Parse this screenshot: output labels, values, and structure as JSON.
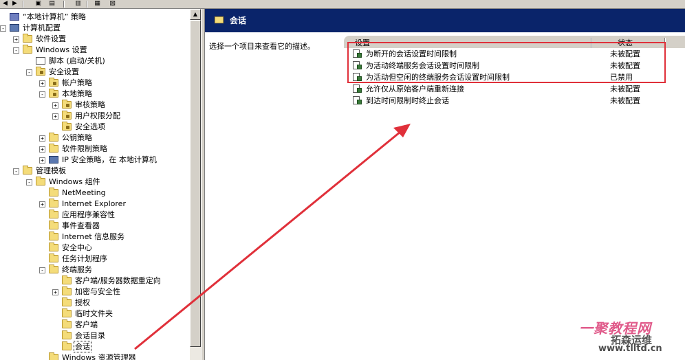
{
  "tree": [
    {
      "label": "“本地计算机” 策略",
      "depth": 0,
      "expander": "",
      "icon": "policy"
    },
    {
      "label": "计算机配置",
      "depth": 0,
      "expander": "-",
      "icon": "computer"
    },
    {
      "label": "软件设置",
      "depth": 1,
      "expander": "+",
      "icon": "folder"
    },
    {
      "label": "Windows 设置",
      "depth": 1,
      "expander": "-",
      "icon": "folder"
    },
    {
      "label": "脚本 (启动/关机)",
      "depth": 2,
      "expander": "",
      "icon": "script"
    },
    {
      "label": "安全设置",
      "depth": 2,
      "expander": "-",
      "icon": "lockfolder"
    },
    {
      "label": "帐户策略",
      "depth": 3,
      "expander": "+",
      "icon": "lockfolder"
    },
    {
      "label": "本地策略",
      "depth": 3,
      "expander": "-",
      "icon": "lockfolder"
    },
    {
      "label": "审核策略",
      "depth": 4,
      "expander": "+",
      "icon": "lockfolder"
    },
    {
      "label": "用户权限分配",
      "depth": 4,
      "expander": "+",
      "icon": "lockfolder"
    },
    {
      "label": "安全选项",
      "depth": 4,
      "expander": "",
      "icon": "lockfolder"
    },
    {
      "label": "公钥策略",
      "depth": 3,
      "expander": "+",
      "icon": "folder"
    },
    {
      "label": "软件限制策略",
      "depth": 3,
      "expander": "+",
      "icon": "folder"
    },
    {
      "label": "IP 安全策略，在 本地计算机",
      "depth": 3,
      "expander": "+",
      "icon": "computer"
    },
    {
      "label": "管理模板",
      "depth": 1,
      "expander": "-",
      "icon": "folder"
    },
    {
      "label": "Windows 组件",
      "depth": 2,
      "expander": "-",
      "icon": "folder"
    },
    {
      "label": "NetMeeting",
      "depth": 3,
      "expander": "",
      "icon": "folder"
    },
    {
      "label": "Internet Explorer",
      "depth": 3,
      "expander": "+",
      "icon": "folder"
    },
    {
      "label": "应用程序兼容性",
      "depth": 3,
      "expander": "",
      "icon": "folder"
    },
    {
      "label": "事件查看器",
      "depth": 3,
      "expander": "",
      "icon": "folder"
    },
    {
      "label": "Internet 信息服务",
      "depth": 3,
      "expander": "",
      "icon": "folder"
    },
    {
      "label": "安全中心",
      "depth": 3,
      "expander": "",
      "icon": "folder"
    },
    {
      "label": "任务计划程序",
      "depth": 3,
      "expander": "",
      "icon": "folder"
    },
    {
      "label": "终端服务",
      "depth": 3,
      "expander": "-",
      "icon": "folder"
    },
    {
      "label": "客户端/服务器数据重定向",
      "depth": 4,
      "expander": "",
      "icon": "folder"
    },
    {
      "label": "加密与安全性",
      "depth": 4,
      "expander": "+",
      "icon": "folder"
    },
    {
      "label": "授权",
      "depth": 4,
      "expander": "",
      "icon": "folder"
    },
    {
      "label": "临时文件夹",
      "depth": 4,
      "expander": "",
      "icon": "folder"
    },
    {
      "label": "客户端",
      "depth": 4,
      "expander": "",
      "icon": "folder"
    },
    {
      "label": "会话目录",
      "depth": 4,
      "expander": "",
      "icon": "folder"
    },
    {
      "label": "会话",
      "depth": 4,
      "expander": "",
      "icon": "folder",
      "selected": true
    },
    {
      "label": "Windows 资源管理器",
      "depth": 3,
      "expander": "",
      "icon": "folder"
    }
  ],
  "right_pane": {
    "title": "会话",
    "description": "选择一个项目来查看它的描述。",
    "columns": {
      "setting": "设置",
      "state": "状态"
    },
    "rows": [
      {
        "name": "为断开的会话设置时间限制",
        "state": "未被配置"
      },
      {
        "name": "为活动终端服务会话设置时间限制",
        "state": "未被配置"
      },
      {
        "name": "为活动但空闲的终端服务会话设置时间限制",
        "state": "已禁用"
      },
      {
        "name": "允许仅从原始客户端重新连接",
        "state": "未被配置"
      },
      {
        "name": "到达时间限制时终止会话",
        "state": "未被配置"
      }
    ]
  },
  "watermark": {
    "brand": "一聚教程网",
    "sub": "拓森运维",
    "url": "www.tlltd.cn"
  },
  "colors": {
    "header_bg": "#0a246a",
    "annotation_red": "#e0303a"
  }
}
